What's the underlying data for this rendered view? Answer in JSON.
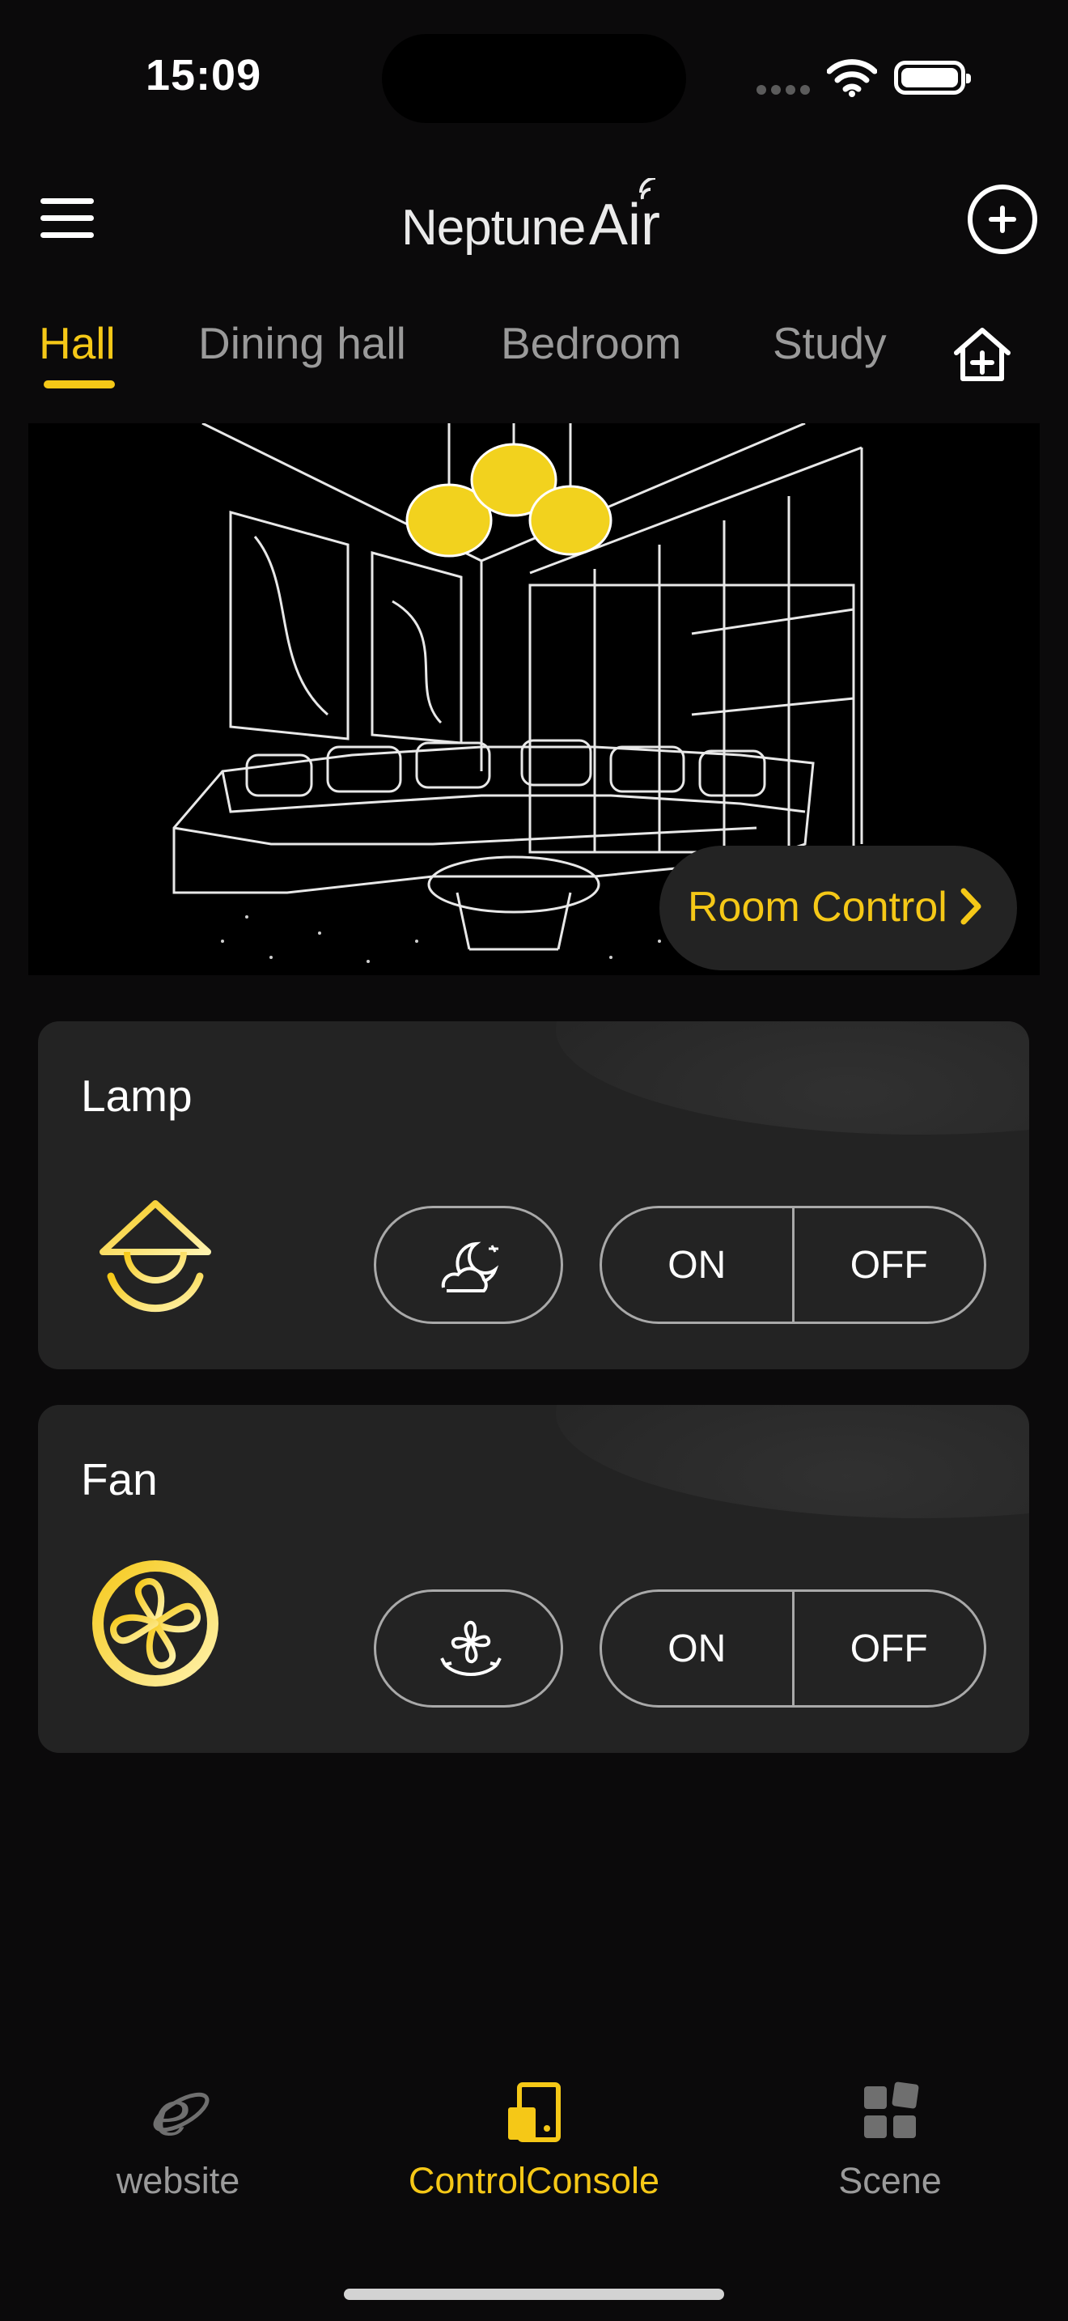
{
  "status_bar": {
    "time": "15:09"
  },
  "header": {
    "logo_text": "NeptuneAir"
  },
  "tabs": [
    {
      "label": "Hall",
      "active": true
    },
    {
      "label": "Dining hall",
      "active": false
    },
    {
      "label": "Bedroom",
      "active": false
    },
    {
      "label": "Study",
      "active": false
    }
  ],
  "banner": {
    "room_control_label": "Room Control"
  },
  "devices": [
    {
      "name": "Lamp",
      "icon": "lamp-icon",
      "mode_icon": "moon-night-mode-icon",
      "on_label": "ON",
      "off_label": "OFF"
    },
    {
      "name": "Fan",
      "icon": "fan-icon",
      "mode_icon": "fan-swing-icon",
      "on_label": "ON",
      "off_label": "OFF"
    }
  ],
  "bottom_nav": [
    {
      "label": "website",
      "icon": "browser-e-icon",
      "active": false
    },
    {
      "label": "ControlConsole",
      "icon": "control-console-icon",
      "active": true
    },
    {
      "label": "Scene",
      "icon": "scene-grid-icon",
      "active": false
    }
  ],
  "colors": {
    "accent": "#f5c817",
    "background": "#0b0a0b",
    "card": "#232323"
  }
}
